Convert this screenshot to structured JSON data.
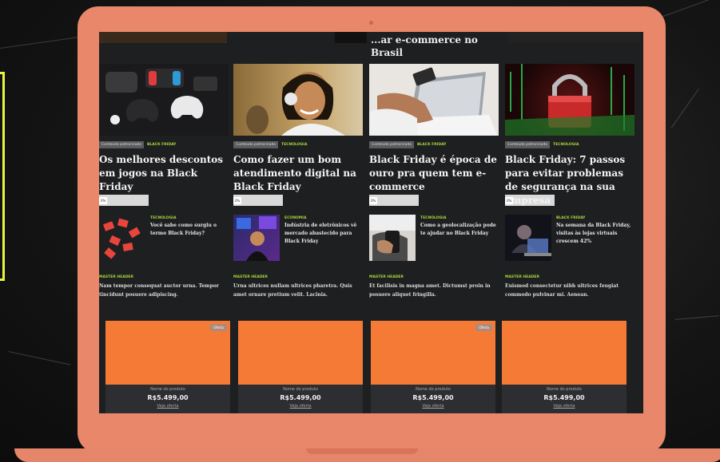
{
  "top_row": {
    "title": "...ar e-commerce no Brasil"
  },
  "cards": [
    {
      "tags": [
        "Conteúdo patrocinado",
        "BLACK FRIDAY"
      ],
      "title": "Os melhores descontos em jogos na Black Friday",
      "share_label": "0%",
      "thumb_icon": "game-controllers-image"
    },
    {
      "tags": [
        "Conteúdo patrocinado",
        "TECNOLOGIA"
      ],
      "title": "Como fazer um bom atendimento digital na Black Friday",
      "share_label": "0%",
      "thumb_icon": "headset-woman-image"
    },
    {
      "tags": [
        "Conteúdo patrocinado",
        "BLACK FRIDAY"
      ],
      "title": "Black Friday é época de ouro pra quem tem e-commerce",
      "share_label": "0%",
      "thumb_icon": "laptop-card-image"
    },
    {
      "tags": [
        "Conteúdo patrocinado",
        "TECNOLOGIA"
      ],
      "title": "Black Friday: 7 passos para evitar problemas de segurança na sua empresa",
      "share_label": "0%",
      "thumb_icon": "padlock-image"
    }
  ],
  "mini_posts": [
    {
      "category": "TECNOLOGIA",
      "text": "Você sabe como surgiu o termo Black Friday?",
      "thumb_icon": "red-tags-image"
    },
    {
      "category": "ECONOMIA",
      "text": "Indústria de eletrônicos vê mercado abastecido para Black Friday",
      "thumb_icon": "electronics-image"
    },
    {
      "category": "TECNOLOGIA",
      "text": "Como a geolocalização pode te ajudar no Black Friday",
      "thumb_icon": "phone-hands-image"
    },
    {
      "category": "BLACK FRIDAY",
      "text": "Na semana da Black Friday, visitas às lojas virtuais crescem 42%",
      "thumb_icon": "person-laptop-image"
    }
  ],
  "master_posts": [
    {
      "label": "MASTER HEADER",
      "text": "Nam tempor consequat auctor urna. Tempor tincidunt posuere adipiscing."
    },
    {
      "label": "MASTER HEADER",
      "text": "Urna ultrices nullam ultrices pharetra. Quis amet ornare pretium velit. Lacinia."
    },
    {
      "label": "MASTER HEADER",
      "text": "Et facilisis in magna amet. Dictumst proin in posuere aliquet fringilla."
    },
    {
      "label": "MASTER HEADER",
      "text": "Euismod consectetur nibh ultrices feugiat commodo pulvinar mi. Aenean."
    }
  ],
  "products": [
    {
      "badge": "Oferta",
      "name": "Nome do produto",
      "price": "R$5.499,00",
      "link": "Veja oferta"
    },
    {
      "badge": "",
      "name": "Nome do produto",
      "price": "R$5.499,00",
      "link": "Veja oferta"
    },
    {
      "badge": "Oferta",
      "name": "Nome do produto",
      "price": "R$5.499,00",
      "link": "Veja oferta"
    },
    {
      "badge": "",
      "name": "Nome do produto",
      "price": "R$5.499,00",
      "link": "Veja oferta"
    }
  ],
  "colors": {
    "laptop": "#e8876a",
    "accent_green": "#a6d63a",
    "product_orange": "#f47a35",
    "frame_yellow": "#e9f53a"
  }
}
